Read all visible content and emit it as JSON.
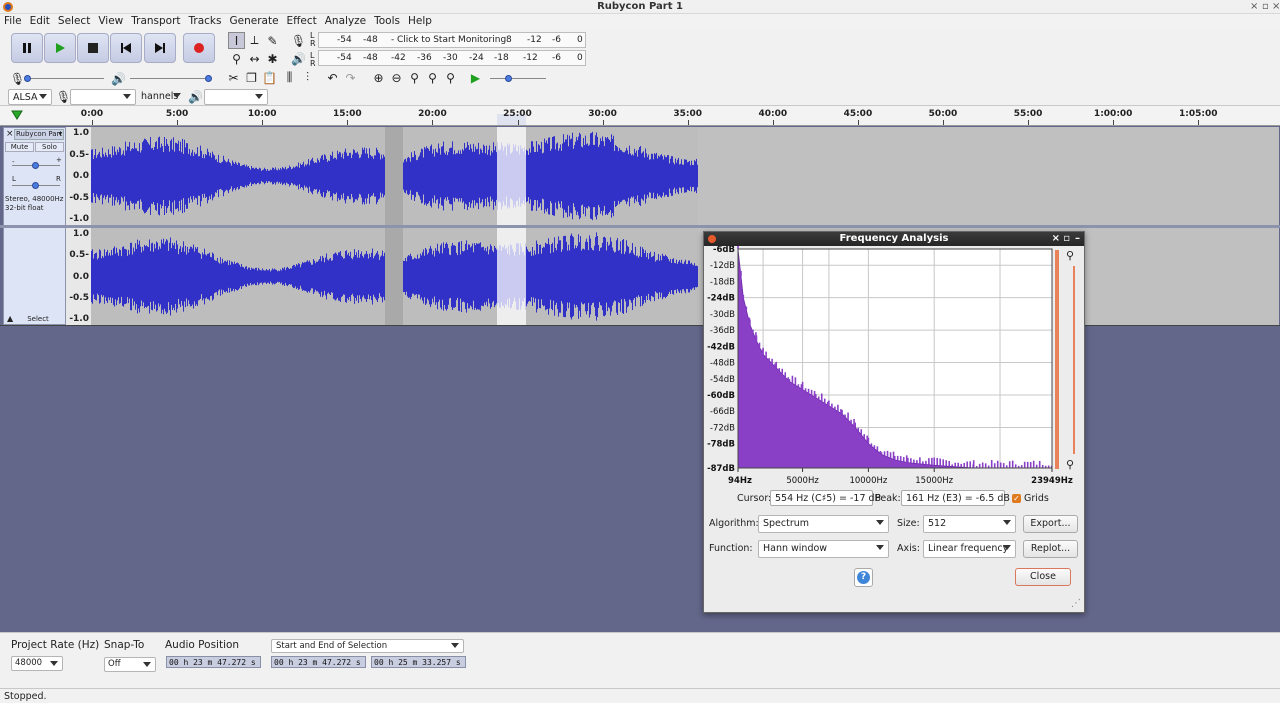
{
  "window": {
    "title": "Rubycon Part 1"
  },
  "menu": [
    "File",
    "Edit",
    "Select",
    "View",
    "Transport",
    "Tracks",
    "Generate",
    "Effect",
    "Analyze",
    "Tools",
    "Help"
  ],
  "meters": {
    "record_prompt": "Click to Start Monitoring",
    "record_ticks": [
      "-54",
      "-48",
      "-",
      "8",
      "-12",
      "-6",
      "0"
    ],
    "play_ticks": [
      "-54",
      "-48",
      "-42",
      "-36",
      "-30",
      "-24",
      "-18",
      "-12",
      "-6",
      "0"
    ],
    "lr": [
      "L",
      "R"
    ]
  },
  "device": {
    "host": "ALSA",
    "channels": "hannels"
  },
  "ruler": {
    "ticks": [
      "0:00",
      "5:00",
      "10:00",
      "15:00",
      "20:00",
      "25:00",
      "30:00",
      "35:00",
      "40:00",
      "45:00",
      "50:00",
      "55:00",
      "1:00:00",
      "1:05:00"
    ]
  },
  "track": {
    "name": "Rubycon Part",
    "mute": "Mute",
    "solo": "Solo",
    "pan_left": "L",
    "pan_right": "R",
    "info_line1": "Stereo, 48000Hz",
    "info_line2": "32-bit float",
    "select": "Select",
    "scale": [
      "1.0",
      "0.5-",
      "0.0",
      "-0.5",
      "-1.0"
    ]
  },
  "freq_dialog": {
    "title": "Frequency Analysis",
    "y_labels": [
      "-6dB",
      "-12dB",
      "-18dB",
      "-24dB",
      "-30dB",
      "-36dB",
      "-42dB",
      "-48dB",
      "-54dB",
      "-60dB",
      "-66dB",
      "-72dB",
      "-78dB",
      "-87dB"
    ],
    "x_labels": [
      "94Hz",
      "5000Hz",
      "10000Hz",
      "15000Hz",
      "23949Hz"
    ],
    "cursor_label": "Cursor:",
    "cursor_value": "554 Hz (C♯5) = -17 dB",
    "peak_label": "Peak:",
    "peak_value": "161 Hz (E3) = -6.5 dB",
    "grids_label": "Grids",
    "grids_checked": true,
    "algorithm_label": "Algorithm:",
    "algorithm_value": "Spectrum",
    "size_label": "Size:",
    "size_value": "512",
    "export_label": "Export...",
    "function_label": "Function:",
    "function_value": "Hann window",
    "axis_label": "Axis:",
    "axis_value": "Linear frequency",
    "replot_label": "Replot...",
    "help_label": "?",
    "close_label": "Close",
    "spectrum_color": "#8a3fc7"
  },
  "chart_data": {
    "type": "area",
    "title": "",
    "xlabel": "",
    "ylabel": "",
    "x_axis": "Linear frequency",
    "xlim": [
      94,
      23949
    ],
    "ylim": [
      -87,
      -6
    ],
    "x": [
      94,
      500,
      1000,
      1500,
      2000,
      3000,
      4000,
      5000,
      6000,
      7000,
      8000,
      9000,
      10000,
      11000,
      12000,
      13000,
      15000,
      18000,
      23949
    ],
    "series": [
      {
        "values": [
          -6,
          -24,
          -34,
          -40,
          -45,
          -50,
          -55,
          -58,
          -61,
          -64,
          -67,
          -72,
          -78,
          -82,
          -84,
          -85,
          -86,
          -87,
          -87
        ]
      }
    ],
    "grid": true
  },
  "selection_toolbar": {
    "project_rate_label": "Project Rate (Hz)",
    "project_rate_value": "48000",
    "snap_to_label": "Snap-To",
    "snap_to_value": "Off",
    "audio_position_label": "Audio Position",
    "audio_position_value": "00 h 23 m 47.272 s",
    "selection_mode": "Start and End of Selection",
    "selection_start": "00 h 23 m 47.272 s",
    "selection_end": "00 h 25 m 33.257 s"
  },
  "status": "Stopped.",
  "colors": {
    "wave": "#3131c8",
    "wave_rms": "#6a6ae0",
    "selection": "#ffffff",
    "background": "#63678a"
  }
}
